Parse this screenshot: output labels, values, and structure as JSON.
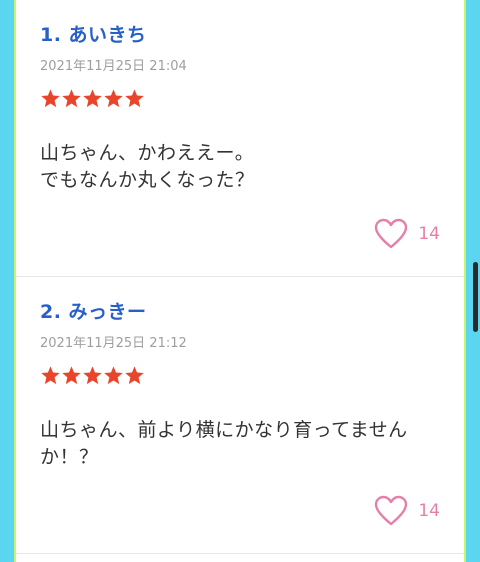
{
  "comments": [
    {
      "name": "1. あいきち",
      "date": "2021年11月25日 21:04",
      "rating": 5,
      "lines": [
        "山ちゃん、かわええー。",
        "でもなんか丸くなった？"
      ],
      "likes": "14"
    },
    {
      "name": "2. みっきー",
      "date": "2021年11月25日 21:12",
      "rating": 5,
      "lines": [
        "山ちゃん、前より横にかなり育ってません",
        "か！？"
      ],
      "likes": "14"
    }
  ],
  "colors": {
    "star": "#e8452a",
    "name": "#2760c9",
    "heart": "#e67fa8"
  },
  "icons": {
    "star": "star-icon",
    "like": "heart-outline-icon"
  }
}
